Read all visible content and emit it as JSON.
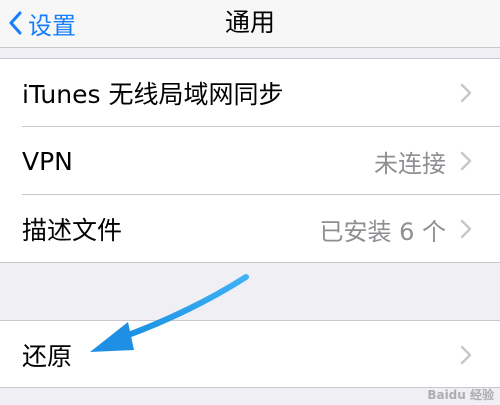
{
  "navbar": {
    "back_label": "设置",
    "title": "通用"
  },
  "group1": {
    "rows": [
      {
        "label": "iTunes 无线局域网同步",
        "value": ""
      },
      {
        "label": "VPN",
        "value": "未连接"
      },
      {
        "label": "描述文件",
        "value": "已安装 6 个"
      }
    ]
  },
  "group2": {
    "rows": [
      {
        "label": "还原",
        "value": ""
      }
    ]
  },
  "watermark": "Baidu 经验",
  "colors": {
    "accent": "#157efb",
    "arrow": "#1f9ae8",
    "background": "#efeff4"
  },
  "icons": {
    "back": "chevron-left-icon",
    "disclosure": "chevron-right-icon"
  }
}
